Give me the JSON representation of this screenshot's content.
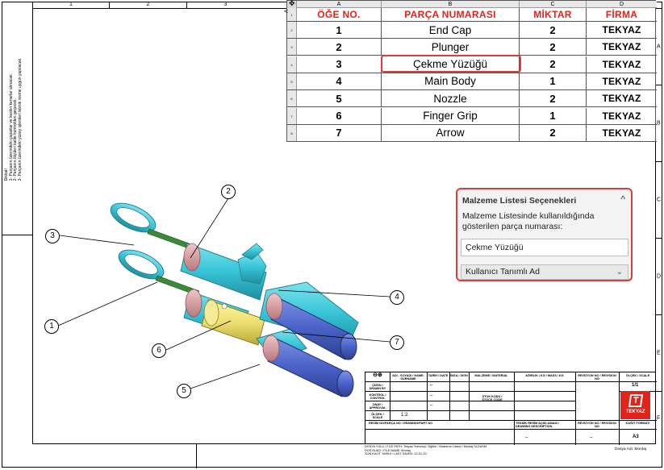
{
  "sheet": {
    "zone_columns": [
      "1",
      "2",
      "3"
    ],
    "zone_rows": [
      "A",
      "B",
      "C",
      "D",
      "E",
      "F"
    ],
    "side_notes": {
      "heading": "Dikkat!",
      "lines": [
        "1- Parçanın üzerindeki çapaklar ve keskin kenarlar alınacak.",
        "2- Parçanın ölçüleri kalite kontrolden geçecek.",
        "3- Parçanın üzerindeki yüzey işlemleri teknik resme uygun yapılacak."
      ]
    }
  },
  "bom": {
    "columns": [
      "A",
      "B",
      "C",
      "D"
    ],
    "headers": {
      "item_no": "ÖĞE NO.",
      "part_number": "PARÇA NUMARASI",
      "quantity": "MİKTAR",
      "company": "FİRMA"
    },
    "row_numbers": [
      "1",
      "2",
      "3",
      "4",
      "5",
      "6",
      "7",
      "8"
    ],
    "rows": [
      {
        "item": "1",
        "part": "End Cap",
        "qty": "2",
        "firm": "TEKYAZ"
      },
      {
        "item": "2",
        "part": "Plunger",
        "qty": "2",
        "firm": "TEKYAZ"
      },
      {
        "item": "3",
        "part": "Çekme Yüzüğü",
        "qty": "2",
        "firm": "TEKYAZ"
      },
      {
        "item": "4",
        "part": "Main Body",
        "qty": "1",
        "firm": "TEKYAZ"
      },
      {
        "item": "5",
        "part": "Nozzle",
        "qty": "2",
        "firm": "TEKYAZ"
      },
      {
        "item": "6",
        "part": "Finger Grip",
        "qty": "1",
        "firm": "TEKYAZ"
      },
      {
        "item": "7",
        "part": "Arrow",
        "qty": "2",
        "firm": "TEKYAZ"
      }
    ],
    "selected_row": 3
  },
  "options_panel": {
    "title": "Malzeme Listesi Seçenekleri",
    "description": "Malzeme Listesinde kullanıldığında gösterilen parça numarası:",
    "part_number_value": "Çekme Yüzüğü",
    "display_mode": "Kullanıcı Tanımlı Ad",
    "collapse_glyph": "^",
    "dropdown_glyph": "⌄"
  },
  "balloons": [
    "1",
    "2",
    "3",
    "4",
    "5",
    "6",
    "7"
  ],
  "title_block": {
    "headers": [
      "ADI - SOYADI / NAME-SURNAME",
      "TARİH / DATE",
      "İMZA / SIGN",
      "MALZEME / MATERIAL",
      "AĞIRLIK / KG / MASS / KG",
      "REVİZYON NO / REVISION NO",
      "ÖLÇEK / SCALE"
    ],
    "roles": [
      "ÇİZEN / DRAWN BY",
      "KONTROL / CONTROL",
      "ONAY / APPROVAL",
      "ÖLÇEK / SCALE"
    ],
    "dash": "–",
    "stock_label": "STOK KODU / STOCK CODE",
    "scale_value": "1:2",
    "sheet_label": "SAYFA / SHEET",
    "sheet_value": "1/1",
    "drawing_no_label": "RESİM NO/PARÇA NO / DRAWING/PART NO",
    "desc_label": "TEKNİK RESİM AÇIKLAMASI / DRAWING DESCRIPTION",
    "rev_label": "REVİZYON NO / REVISION NO",
    "format_label": "KAĞIT FORMATI",
    "format_value": "A3",
    "logo_text": "TEKYAZ",
    "logo_mark": "T"
  },
  "footer": {
    "left_lines": [
      "DOSYA YOLU / FILE PATH: Tekyaz Teknoloji / Eğitim / Malzeme Listesi / Montaj.SLDASM",
      "DOSYA ADI / FILE NAME: Montaj",
      "SON KAYIT TARİHİ / LAST SAVED: 22-01-20"
    ],
    "right_text": "Dosya Adı: Montaj"
  },
  "colors": {
    "accent_red": "#e2231a",
    "highlight_border": "#e03a3a",
    "part_cyan": "#35c4d6",
    "part_blue": "#4a62c8",
    "part_yellow": "#ede070",
    "part_pink": "#d6a0a4",
    "part_green": "#3a8a3a"
  }
}
